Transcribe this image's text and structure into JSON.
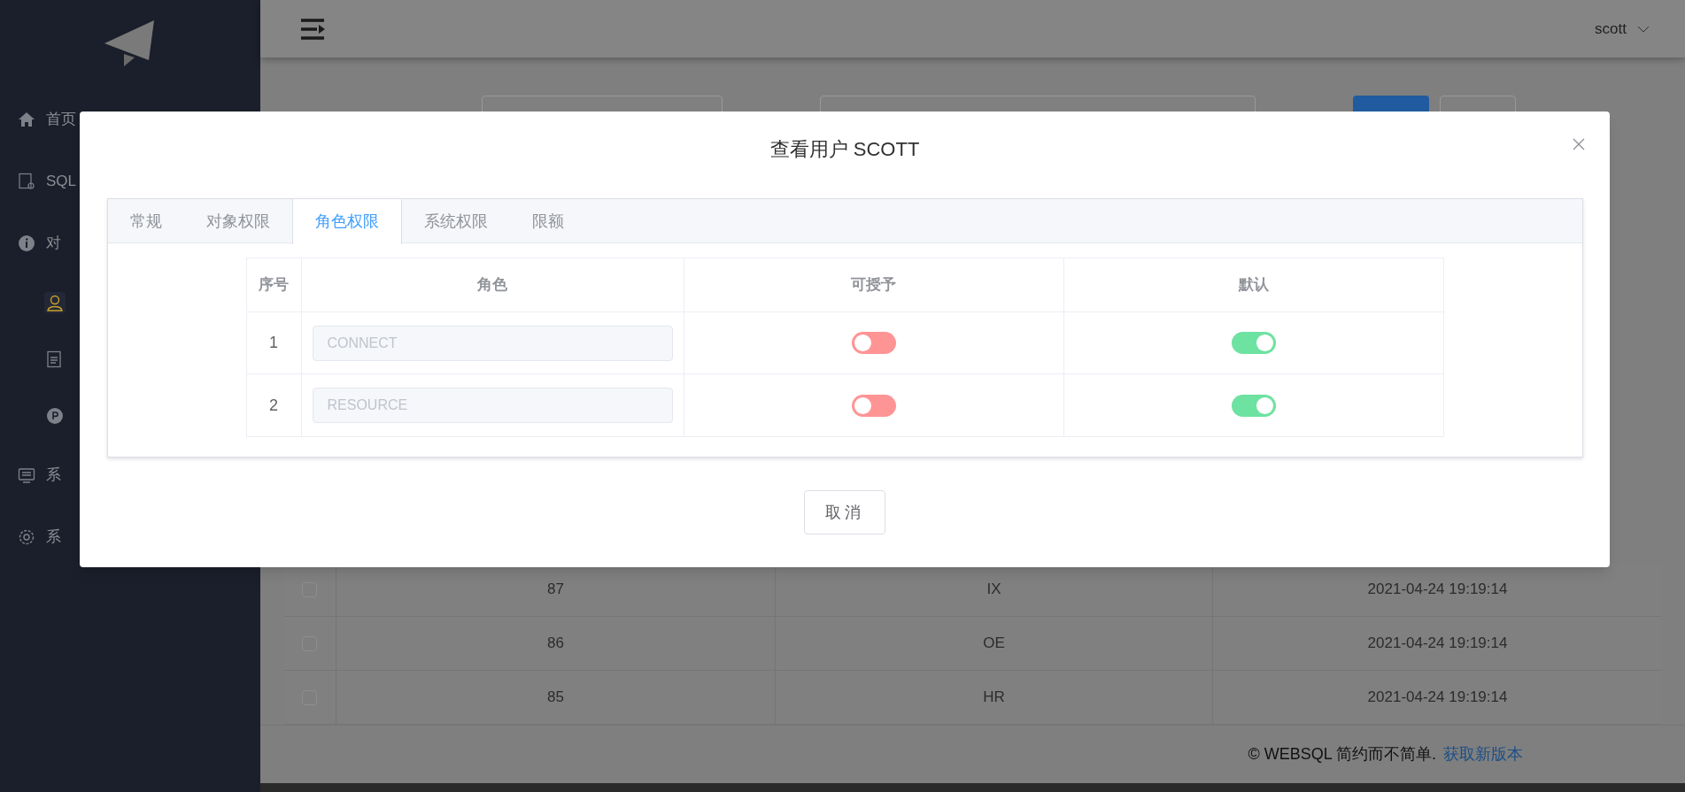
{
  "sidebar": {
    "items": [
      {
        "label": "首页",
        "selected": false
      },
      {
        "label": "SQL",
        "selected": false
      },
      {
        "label": "对",
        "selected": false,
        "children": [
          {
            "selected": true
          },
          {
            "selected": false
          },
          {
            "selected": false
          }
        ]
      },
      {
        "label": "系",
        "selected": false
      },
      {
        "label": "系",
        "selected": false
      }
    ]
  },
  "header": {
    "user": "scott"
  },
  "background_table": {
    "rows": [
      {
        "checked": false,
        "column_2": "87",
        "column_3": "IX",
        "column_4": "2021-04-24 19:19:14"
      },
      {
        "checked": false,
        "column_2": "86",
        "column_3": "OE",
        "column_4": "2021-04-24 19:19:14"
      },
      {
        "checked": false,
        "column_2": "85",
        "column_3": "HR",
        "column_4": "2021-04-24 19:19:14"
      }
    ]
  },
  "footer": {
    "copyright": "© WEBSQL 简约而不简单.",
    "link": "获取新版本"
  },
  "dialog": {
    "title": "查看用户 SCOTT",
    "tabs": [
      {
        "label": "常规",
        "selected": false
      },
      {
        "label": "对象权限",
        "selected": false
      },
      {
        "label": "角色权限",
        "selected": true
      },
      {
        "label": "系统权限",
        "selected": false
      },
      {
        "label": "限额",
        "selected": false
      }
    ],
    "columns": [
      "序号",
      "角色",
      "可授予",
      "默认"
    ],
    "rows": [
      {
        "index": "1",
        "role": "CONNECT",
        "disabled": true,
        "grantable": false,
        "default": true
      },
      {
        "index": "2",
        "role": "RESOURCE",
        "disabled": true,
        "grantable": false,
        "default": true
      }
    ],
    "cancel": "取消"
  }
}
